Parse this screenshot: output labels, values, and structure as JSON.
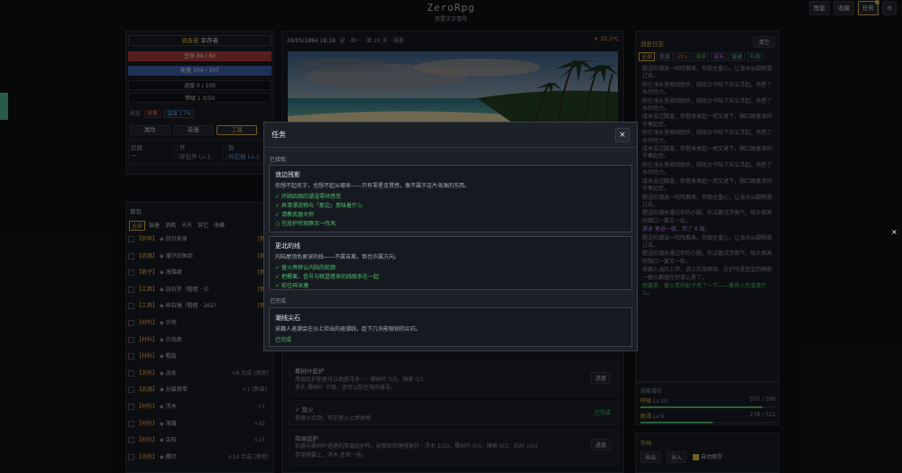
{
  "header": {
    "title": "ZeroRpg",
    "subtitle": "放置文字冒险",
    "buttons": [
      "图鉴",
      "收藏",
      "任务"
    ],
    "gear_icon": "gear-icon"
  },
  "player": {
    "name_tag": "调查者",
    "name": "幸存者",
    "hp": "生命 80 / 80",
    "mana": "能量 104 / 107",
    "exp": "进度 0 / 100",
    "level": "等级 1 0/50",
    "status_label": "状态",
    "status_tags": [
      "疲惫",
      "温度 17%"
    ],
    "tabs": [
      "属性",
      "装备",
      "工具"
    ],
    "equip": [
      {
        "slot": "武器",
        "value": "—"
      },
      {
        "slot": "斧",
        "value": "碎石斧 Lv.1"
      },
      {
        "slot": "镐",
        "value": "碎石镐 Lv.1"
      }
    ]
  },
  "bag": {
    "title": "背包",
    "filters": [
      "全部",
      "装备",
      "消耗",
      "卡片",
      "其它",
      "收藏"
    ],
    "items": [
      {
        "tag": "【饰甲】",
        "name": "旧贝壳身",
        "extra": "[新"
      },
      {
        "tag": "【武器】",
        "name": "潮汐旧鱼剑",
        "extra": "[新"
      },
      {
        "tag": "【裤子】",
        "name": "海藻裙",
        "extra": "[新"
      },
      {
        "tag": "【工具】",
        "name": "旧石斧（粗糙 · 0）",
        "extra": "[新"
      },
      {
        "tag": "【工具】",
        "name": "碎石镐（粗糙 · 162）",
        "extra": "[新"
      },
      {
        "tag": "【材料】",
        "name": "贝壳",
        "extra": ""
      },
      {
        "tag": "【材料】",
        "name": "贝壳串",
        "extra": ""
      },
      {
        "tag": "【材料】",
        "name": "粗盐",
        "extra": ""
      },
      {
        "tag": "【消耗】",
        "name": "淡水",
        "count": "×8",
        "btn1": "合成",
        "btn2": "[使用]"
      },
      {
        "tag": "【武器】",
        "name": "分装背带",
        "count": "×1",
        "btn1": "[新装]",
        "btn2": ""
      },
      {
        "tag": "【材料】",
        "name": "浮木",
        "count": "×1",
        "btn1": "",
        "btn2": ""
      },
      {
        "tag": "【材料】",
        "name": "海藻",
        "count": "×32",
        "btn1": "",
        "btn2": ""
      },
      {
        "tag": "【材料】",
        "name": "尖石",
        "count": "×15",
        "btn1": "",
        "btn2": ""
      },
      {
        "tag": "【消耗】",
        "name": "椰贝",
        "count": "×14",
        "btn1": "合成",
        "btn2": "[使用]"
      }
    ]
  },
  "center": {
    "time": "26/05/1884 18:18",
    "sep": "夏 · 周一 · 第 26 天 · 涌潮",
    "temp": "32.3°C",
    "tasks": [
      {
        "title": "椰树叶庇护",
        "desc": "简易庇护能更可以地搜寻多一 · 椰树叶 0/5、绳索 0/1",
        "sub": "手头 椰树叶 不够，还可以前往海岸搜寻。",
        "state": "进度"
      },
      {
        "title": "✓ 营火",
        "desc": "搭营火点燃，可在营火上烤食物",
        "sub": "",
        "state": "已完成"
      },
      {
        "title": "简易庇护",
        "desc": "石器与椰树叶搭建的简易庇护所，能帮助你睡得更好 · 浮木 1/10、椰树叶 0/5、绳索 0/2、石材 19/2",
        "sub": "存储需要上，浮木 还差一些。",
        "state": "进度"
      }
    ]
  },
  "log": {
    "title": "消息日志",
    "clear": "清空",
    "tabs": [
      "全部",
      "信息",
      "战斗",
      "收获",
      "成长",
      "旅途",
      "外观"
    ],
    "entries": [
      "腥涩的潮波一阵阵推来，你稳住重心，让海水从脚侧滑过去。",
      "你在浅水里来回趟步，脚底沙子陷下去又浮起，熟悉了水的托力。",
      "你在浅水里来回趟步，脚底沙子陷下去又浮起，熟悉了水的托力。",
      "咸水没过膝盖，你借身体起一把又退下，胸口跟着浪的节奏起伏。",
      "你在浅水里来回趟步，脚底沙子陷下去又浮起，熟悉了水的托力。",
      "咸水没过膝盖，你借身体起一把又退下，胸口跟着浪的节奏起伏。",
      "你在浅水里来回趟步，脚底沙子陷下去又浮起，熟悉了水的托力。",
      "咸水没过膝盖，你借身体起一把又退下，胸口跟着浪的节奏起伏。",
      "腥涩的潮波一阵阵推来，你稳住重心，让海水从脚侧滑过去。",
      "腥涩的潮水漫过你的小腿，你试着沉浮换气，吸头推高时胸口一紧又一松。",
      "游泳 更进一级，到了 6 级。",
      "腥涩的潮波一阵阵推来，你稳住重心，让海水从脚侧滑过去。",
      "腥涩的潮水漫过你的小腿，你试着沉浮换气，吸头推高时胸口一紧又一松。",
      "采摘入浅的上岸，谜上的海草线、在护所里堂定的残桩一根头都搜在你拿心里了。",
      "雨暮里，营火青的影子亮了一下——像有人在盘算什么。"
    ]
  },
  "skills": {
    "title": "技能增长",
    "rows": [
      {
        "name": "呼吸",
        "level": "Lv.10",
        "value": "537 / 598",
        "fill": 0.9
      },
      {
        "name": "耐渴",
        "level": "Lv.9",
        "value": "278 / 521",
        "fill": 0.53
      }
    ]
  },
  "storage": {
    "title": "存档",
    "buttons": [
      "导出",
      "导入"
    ],
    "auto": "自动保存"
  },
  "modal": {
    "title": "任务",
    "section_active": "已接取",
    "section_done": "已完成",
    "cards": [
      {
        "title": "浪边残影",
        "desc": "你想不起名字，也想不起从哪来——只有零星连贯感，像不属于这片海滩的东西。",
        "objectives": [
          {
            "done": true,
            "text": "环顾四周的潮湿零碎感受"
          },
          {
            "done": true,
            "text": "弄清漂流物与「那边」意味着什么"
          },
          {
            "done": true,
            "text": "请教武器大师"
          },
          {
            "done": false,
            "text": "在庇护所观察另一阵风"
          }
        ]
      },
      {
        "title": "更北的线",
        "desc": "内陆屋顶色更深的线——不属苦离，但也许属方向。",
        "objectives": [
          {
            "done": true,
            "text": "营火旁辨认内陆的轮廓"
          },
          {
            "done": true,
            "text": "把椰果、信号与眺望塔来的线联系在一起"
          },
          {
            "done": true,
            "text": "前往碎冰塘"
          }
        ]
      },
      {
        "title": "潮线尖石",
        "desc": "采籍人退潮会在沙上捡出的退潮线，趁下几块能锻锐的尖石。",
        "state": "已完成"
      }
    ],
    "close": "×"
  }
}
